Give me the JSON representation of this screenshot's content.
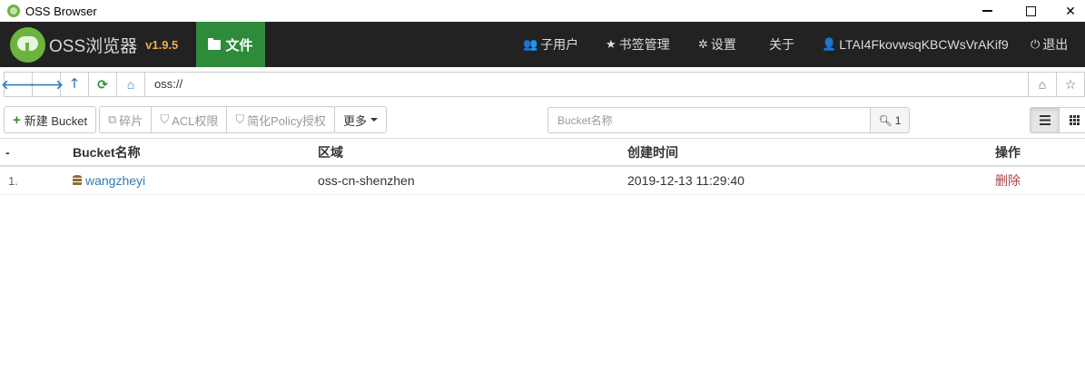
{
  "window": {
    "title": "OSS Browser",
    "min_icon": "minimize-icon",
    "max_icon": "maximize-icon",
    "close_icon": "close-icon"
  },
  "navbar": {
    "app_name": "OSS浏览器",
    "version": "v1.9.5",
    "active_tab": "文件",
    "items": {
      "subusers": "子用户",
      "bookmarks": "书签管理",
      "settings": "设置",
      "about": "关于",
      "account": "LTAI4FkovwsqKBCWsVrAKif9",
      "logout": "退出"
    }
  },
  "address": {
    "value": "oss://"
  },
  "toolbar": {
    "new_bucket": "新建 Bucket",
    "fragments": "碎片",
    "acl": "ACL权限",
    "policy": "简化Policy授权",
    "more": "更多"
  },
  "search": {
    "placeholder": "Bucket名称",
    "count": "1"
  },
  "table": {
    "headers": {
      "index": "-",
      "name": "Bucket名称",
      "region": "区域",
      "created": "创建时间",
      "actions": "操作"
    },
    "rows": [
      {
        "index": "1.",
        "name": "wangzheyi",
        "region": "oss-cn-shenzhen",
        "created": "2019-12-13 11:29:40",
        "action": "删除"
      }
    ]
  },
  "colors": {
    "navbar_bg": "#222222",
    "active_tab": "#2e8b3a",
    "version": "#f0ad4e",
    "link": "#337ab7",
    "danger": "#a94442"
  }
}
